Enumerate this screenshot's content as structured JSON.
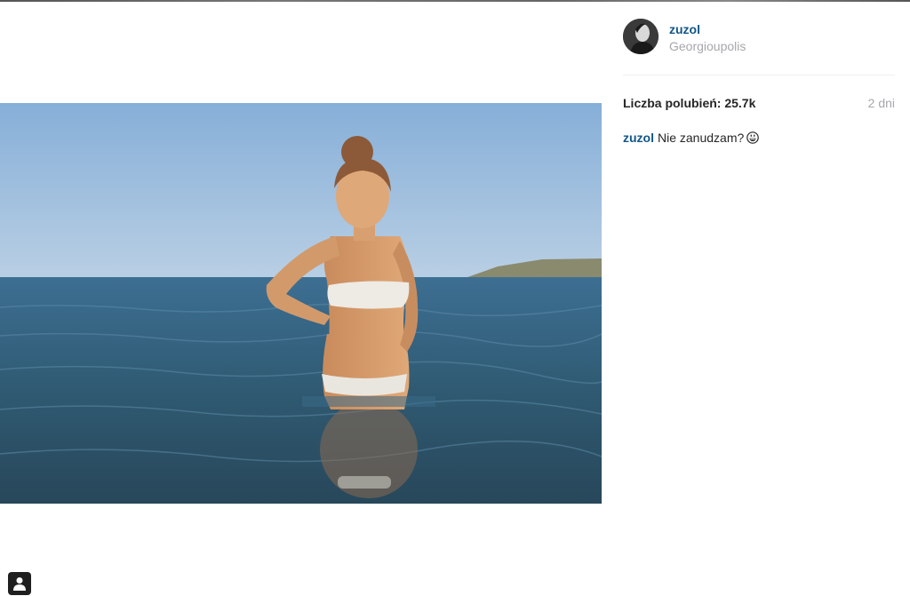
{
  "post": {
    "username": "zuzol",
    "location": "Georgioupolis",
    "likes_text": "Liczba polubień: 25.7k",
    "age": "2 dni",
    "caption_user": "zuzol",
    "caption_text": "Nie zanudzam?",
    "caption_emoji": "grinning-face-icon"
  },
  "colors": {
    "link": "#125688",
    "muted": "#a5a7aa",
    "text": "#262626"
  }
}
